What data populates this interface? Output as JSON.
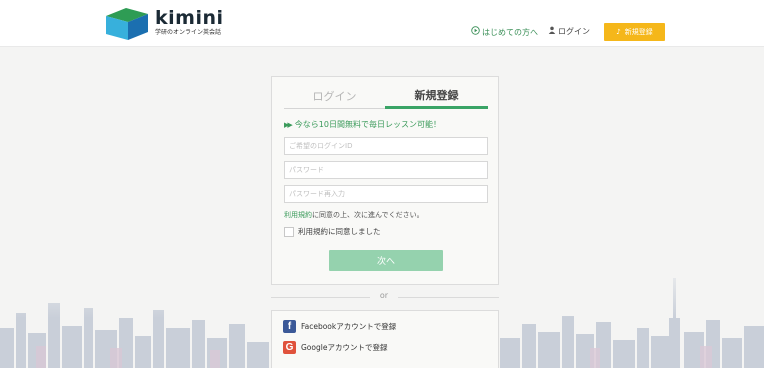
{
  "header": {
    "logo_word": "kimini",
    "logo_tagline": "学研のオンライン英会話",
    "nav_first_time": "はじめての方へ",
    "nav_login": "ログイン",
    "nav_register": "新規登録"
  },
  "form": {
    "tabs": {
      "login": "ログイン",
      "register": "新規登録"
    },
    "promo": "今なら10日間無料で毎日レッスン可能！",
    "login_id_placeholder": "ご希望のログインID",
    "password_placeholder": "パスワード",
    "password_confirm_placeholder": "パスワード再入力",
    "terms_link": "利用規約",
    "terms_suffix": "に同意の上、次に進んでください。",
    "agree_label": "利用規約に同意しました",
    "next_button": "次へ"
  },
  "divider": {
    "or": "or"
  },
  "social": {
    "facebook_label": "Facebookアカウントで登録",
    "google_label": "Googleアカウントで登録"
  },
  "colors": {
    "accent_green": "#3aa466",
    "button_green": "#95d2ae",
    "register_orange": "#f5b71a",
    "facebook_blue": "#3b5998",
    "google_red": "#e0523c"
  }
}
